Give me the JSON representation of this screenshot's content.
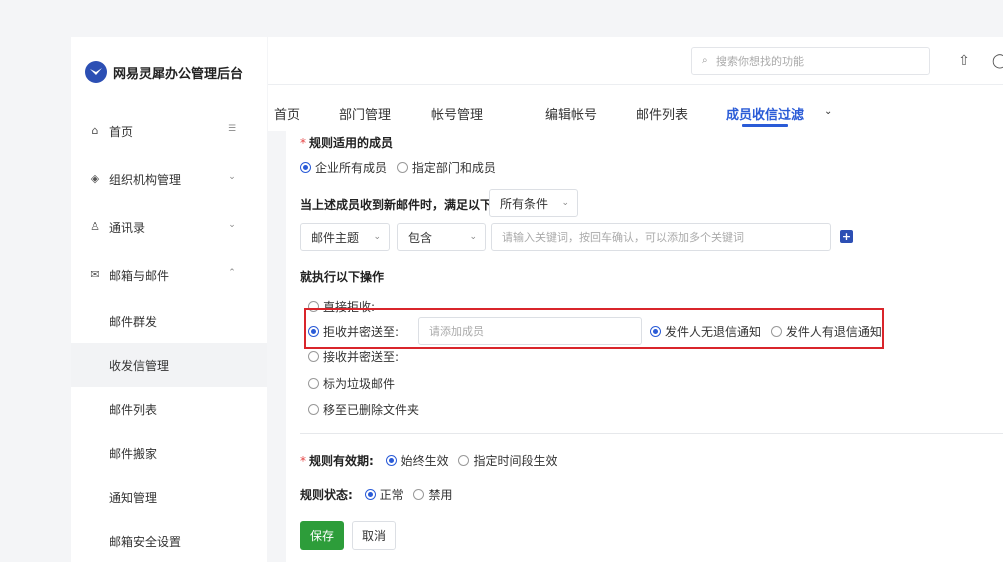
{
  "app": {
    "title": "网易灵犀办公管理后台"
  },
  "sidebar": {
    "items": [
      {
        "label": "首页",
        "icon": "home-icon"
      },
      {
        "label": "组织机构管理",
        "icon": "org-icon"
      },
      {
        "label": "通讯录",
        "icon": "contacts-icon"
      },
      {
        "label": "邮箱与邮件",
        "icon": "mail-icon"
      }
    ],
    "subitems": [
      "邮件群发",
      "收发信管理",
      "邮件列表",
      "邮件搬家",
      "通知管理",
      "邮箱安全设置"
    ],
    "active_subitem": "收发信管理"
  },
  "topbar": {
    "search_placeholder": "搜索你想找的功能"
  },
  "tabs": {
    "items": [
      "首页",
      "部门管理",
      "帐号管理",
      "编辑帐号",
      "邮件列表",
      "成员收信过滤"
    ],
    "active": "成员收信过滤"
  },
  "form": {
    "members_label": "规则适用的成员",
    "members_opt_all": "企业所有成员",
    "members_opt_specific": "指定部门和成员",
    "condition_label": "当上述成员收到新邮件时，满足以下",
    "condition_select": "所有条件",
    "field_select": "邮件主题",
    "op_select": "包含",
    "keyword_placeholder": "请输入关键词，按回车确认，可以添加多个关键词",
    "action_label": "就执行以下操作",
    "action_reject": "直接拒收:",
    "action_reject_send": "拒收并密送至:",
    "add_member_placeholder": "请添加成员",
    "notify_no_bounce": "发件人无退信通知",
    "notify_bounce": "发件人有退信通知",
    "action_accept_send": "接收并密送至:",
    "action_spam": "标为垃圾邮件",
    "action_trash": "移至已删除文件夹",
    "validity_label": "规则有效期:",
    "validity_always": "始终生效",
    "validity_period": "指定时间段生效",
    "status_label": "规则状态:",
    "status_normal": "正常",
    "status_disabled": "禁用",
    "save": "保存",
    "cancel": "取消"
  },
  "colors": {
    "accent": "#2a5bd7",
    "save_green": "#2d9d3a",
    "highlight_red": "#d9252b"
  }
}
